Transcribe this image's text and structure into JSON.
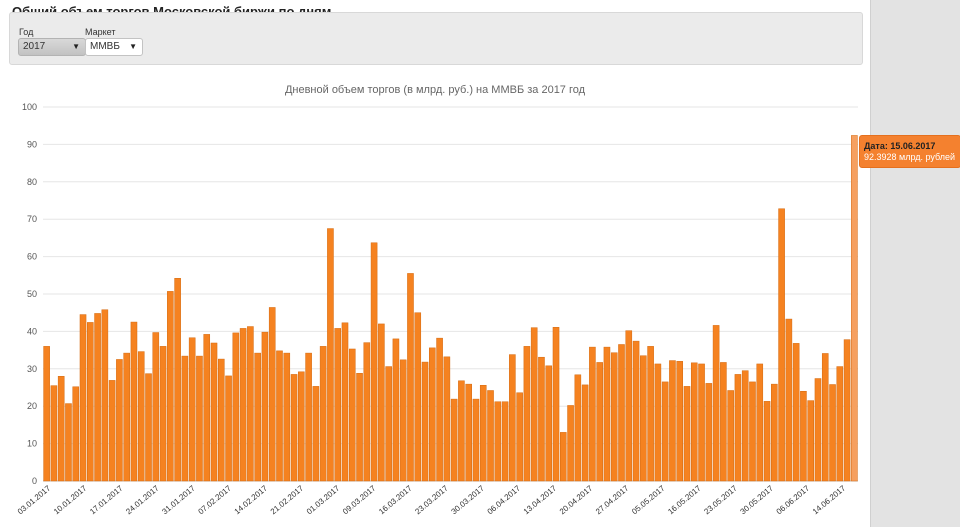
{
  "page": {
    "title": "Общий объем торгов Московской биржи по дням"
  },
  "filters": {
    "year": {
      "label": "Год",
      "value": "2017"
    },
    "market": {
      "label": "Маркет",
      "value": "ММВБ"
    }
  },
  "tooltip": {
    "title": "Дата: 15.06.2017",
    "value": "92.3928 млрд. рублей"
  },
  "colors": {
    "bar": "#f58220",
    "bar_highlight": "#f6a060",
    "grid": "#e6e6e6"
  },
  "chart_data": {
    "type": "bar",
    "title": "Дневной объем торгов (в млрд. руб.) на ММВБ за 2017 год",
    "xlabel": "",
    "ylabel": "",
    "ylim": [
      0,
      100
    ],
    "yticks": [
      0,
      10,
      20,
      30,
      40,
      50,
      60,
      70,
      80,
      90,
      100
    ],
    "grid": true,
    "legend": "none",
    "x_tick_labels": [
      "03.01.2017",
      "10.01.2017",
      "17.01.2017",
      "24.01.2017",
      "31.01.2017",
      "07.02.2017",
      "14.02.2017",
      "21.02.2017",
      "01.03.2017",
      "09.03.2017",
      "16.03.2017",
      "23.03.2017",
      "30.03.2017",
      "06.04.2017",
      "13.04.2017",
      "20.04.2017",
      "27.04.2017",
      "05.05.2017",
      "16.05.2017",
      "23.05.2017",
      "30.05.2017",
      "06.06.2017",
      "14.06.2017"
    ],
    "values": [
      36.0,
      25.5,
      28.0,
      20.7,
      25.2,
      44.5,
      42.4,
      44.8,
      45.8,
      26.9,
      32.5,
      34.2,
      42.5,
      34.6,
      28.7,
      39.7,
      36.0,
      50.7,
      54.2,
      33.4,
      38.3,
      33.4,
      39.2,
      36.9,
      32.6,
      28.1,
      39.6,
      40.8,
      41.3,
      34.2,
      39.8,
      46.4,
      34.8,
      34.2,
      28.5,
      29.2,
      34.2,
      25.3,
      36.0,
      67.5,
      40.8,
      42.3,
      35.3,
      28.8,
      37.0,
      63.7,
      42.0,
      30.6,
      38.0,
      32.4,
      55.5,
      45.0,
      31.8,
      35.6,
      38.2,
      33.2,
      21.9,
      26.8,
      25.9,
      21.9,
      25.6,
      24.2,
      21.2,
      21.2,
      33.8,
      23.6,
      36.0,
      41.0,
      33.1,
      30.8,
      41.1,
      13.0,
      20.2,
      28.4,
      25.7,
      35.8,
      31.7,
      35.8,
      34.3,
      36.5,
      40.2,
      37.4,
      33.5,
      36.0,
      31.3,
      26.5,
      32.2,
      32.0,
      25.3,
      31.6,
      31.3,
      26.1,
      41.6,
      31.7,
      24.2,
      28.5,
      29.5,
      26.5,
      31.3,
      21.3,
      25.9,
      72.8,
      43.3,
      36.8,
      24.0,
      21.5,
      27.4,
      34.1,
      25.8,
      30.6,
      37.8,
      92.3928
    ]
  }
}
